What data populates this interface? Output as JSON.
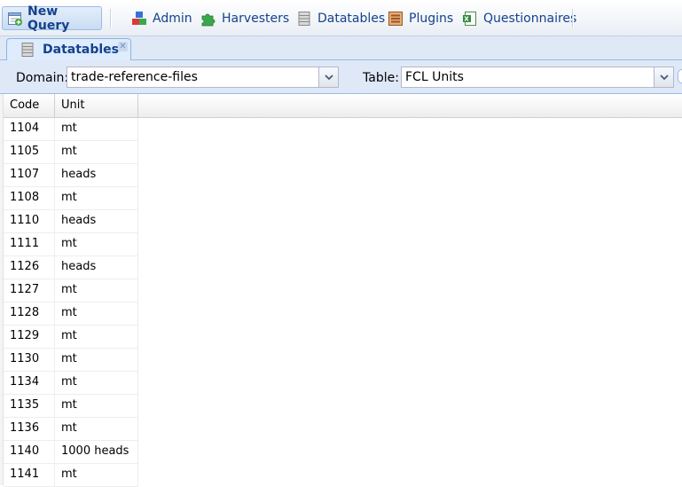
{
  "toolbar": {
    "new_query_label": "New Query",
    "items": [
      {
        "label": "Admin",
        "icon": "admin-icon"
      },
      {
        "label": "Harvesters",
        "icon": "puzzle-icon"
      },
      {
        "label": "Datatables",
        "icon": "datatable-icon"
      },
      {
        "label": "Plugins",
        "icon": "plugin-icon"
      },
      {
        "label": "Questionnaires",
        "icon": "excel-icon"
      }
    ]
  },
  "tabs": [
    {
      "label": "Datatables",
      "icon": "datatable-icon",
      "closable": true
    }
  ],
  "filters": {
    "domain_label": "Domain:",
    "domain_value": "trade-reference-files",
    "table_label": "Table:",
    "table_value": "FCL Units"
  },
  "grid": {
    "columns": [
      "Code",
      "Unit"
    ],
    "rows": [
      {
        "code": "1104",
        "unit": "mt"
      },
      {
        "code": "1105",
        "unit": "mt"
      },
      {
        "code": "1107",
        "unit": "heads"
      },
      {
        "code": "1108",
        "unit": "mt"
      },
      {
        "code": "1110",
        "unit": "heads"
      },
      {
        "code": "1111",
        "unit": "mt"
      },
      {
        "code": "1126",
        "unit": "heads"
      },
      {
        "code": "1127",
        "unit": "mt"
      },
      {
        "code": "1128",
        "unit": "mt"
      },
      {
        "code": "1129",
        "unit": "mt"
      },
      {
        "code": "1130",
        "unit": "mt"
      },
      {
        "code": "1134",
        "unit": "mt"
      },
      {
        "code": "1135",
        "unit": "mt"
      },
      {
        "code": "1136",
        "unit": "mt"
      },
      {
        "code": "1140",
        "unit": "1000 heads"
      },
      {
        "code": "1141",
        "unit": "mt"
      }
    ]
  },
  "colors": {
    "accent_text": "#15428b",
    "toolbar_border": "#99bbe8",
    "panel_bg": "#dfe8f6"
  }
}
